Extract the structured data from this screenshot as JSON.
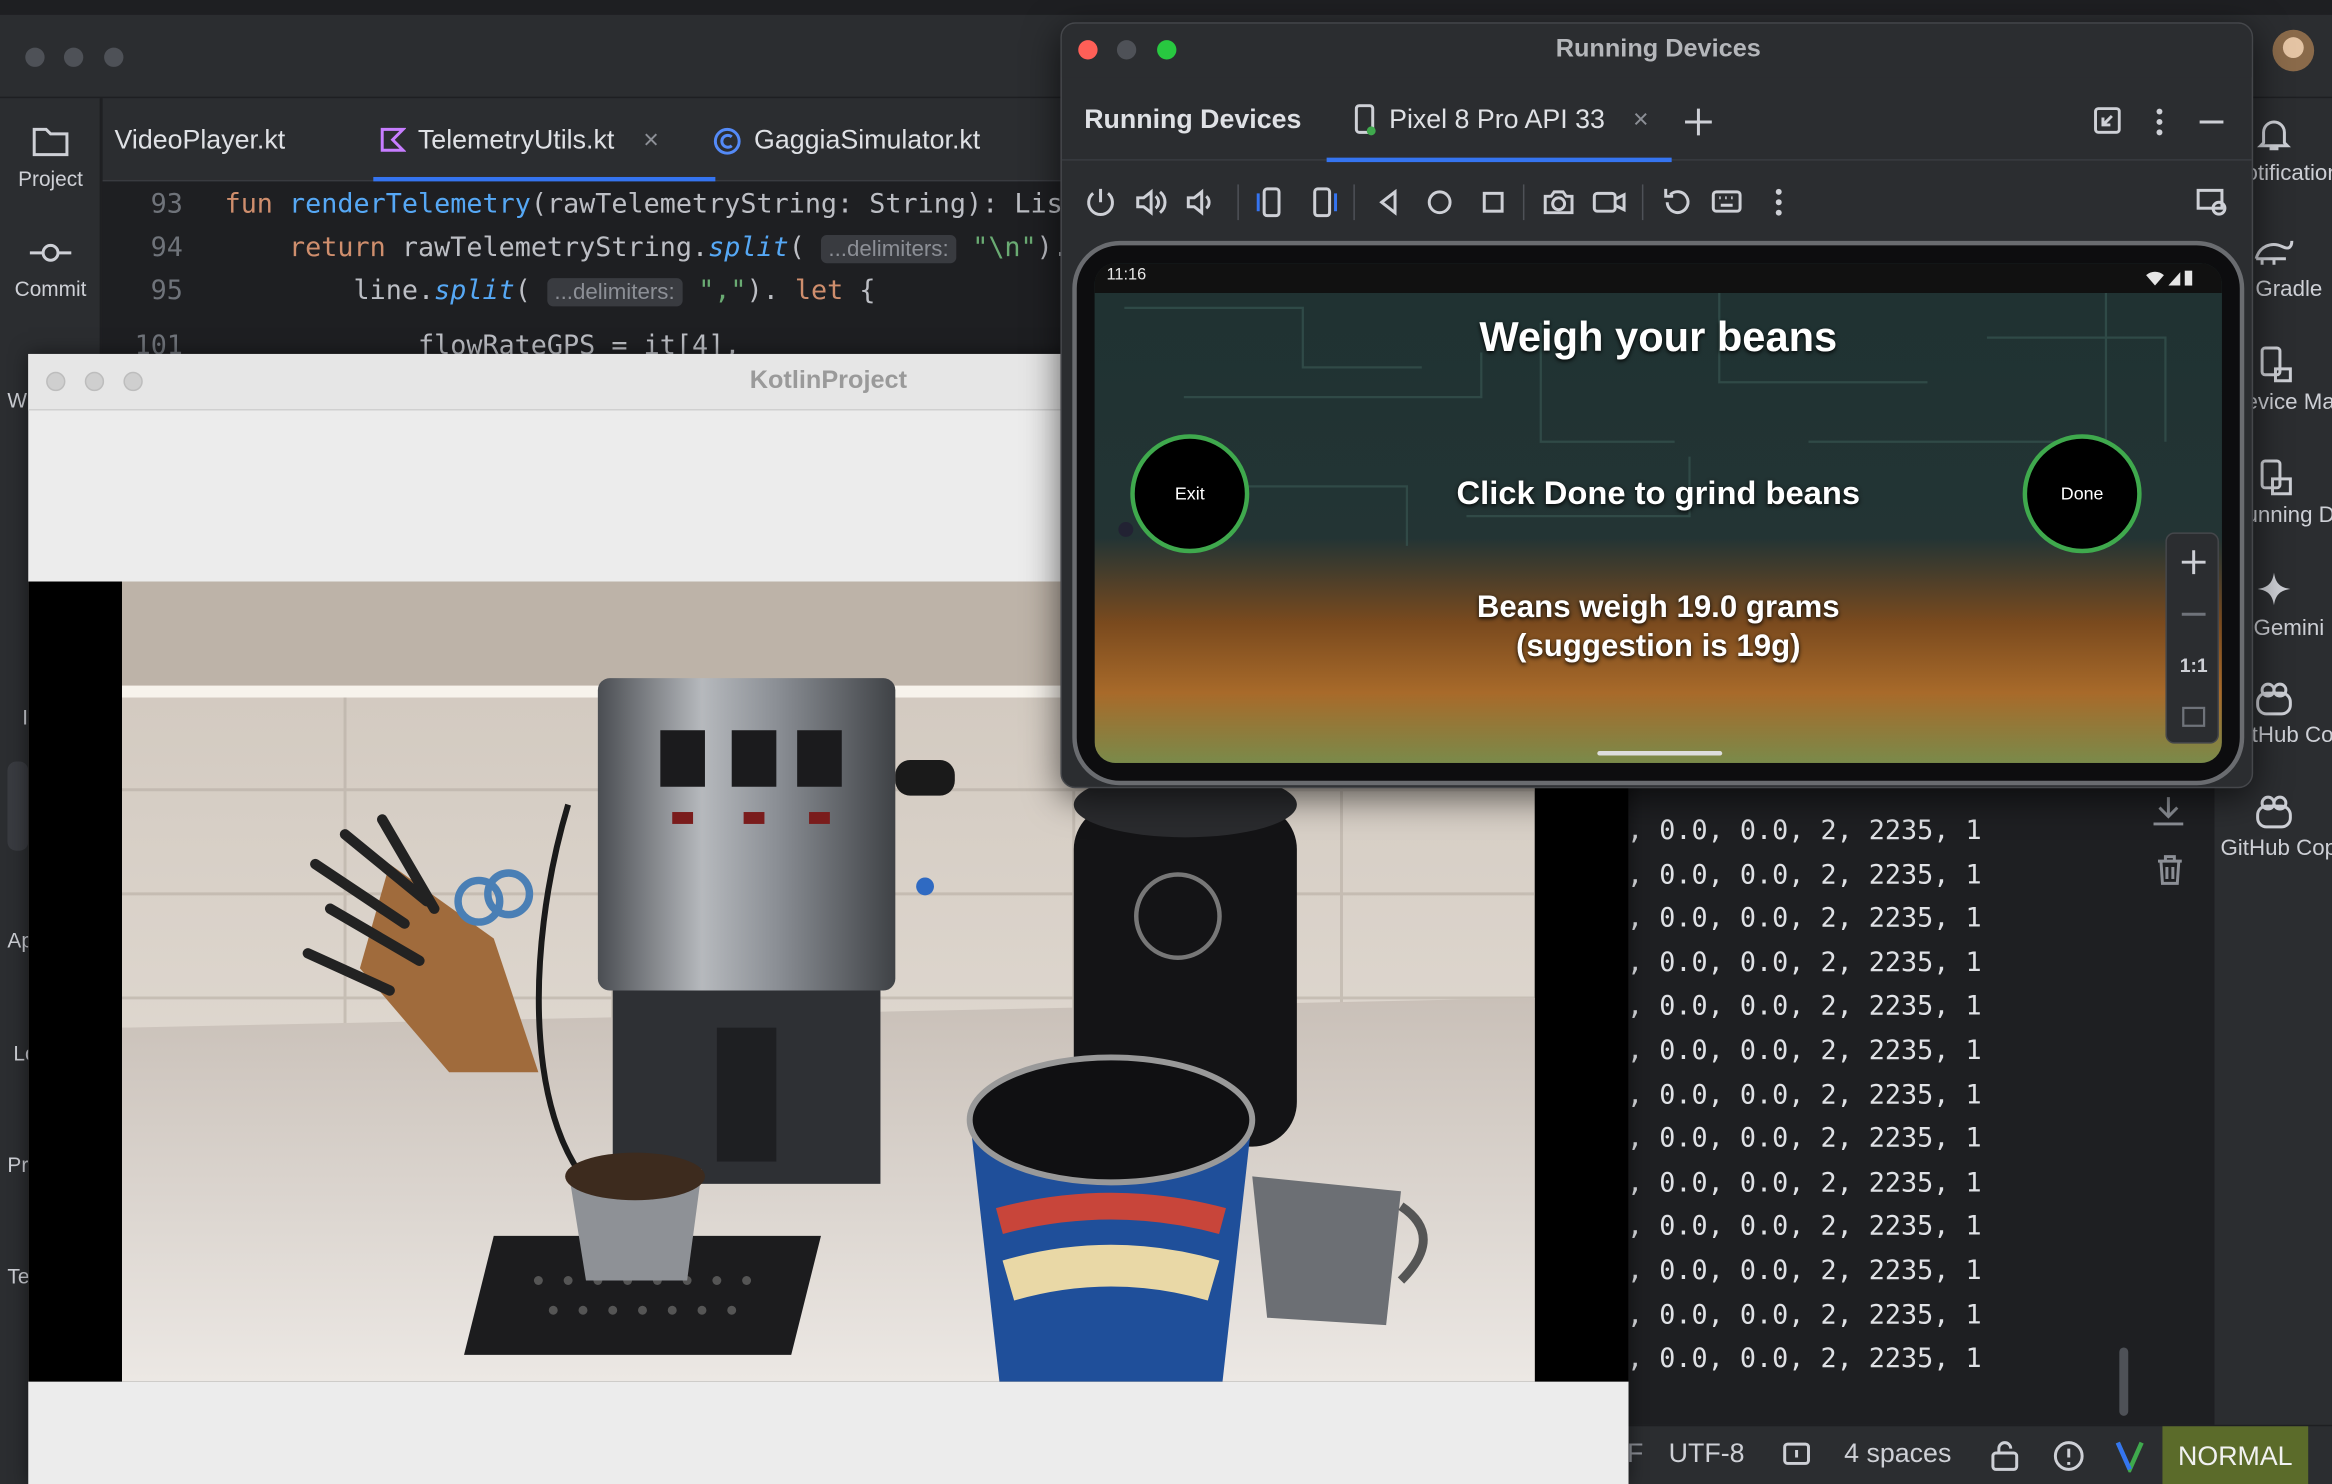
{
  "ide": {
    "tabs": [
      {
        "label": "VideoPlayer.kt"
      },
      {
        "label": "TelemetryUtils.kt"
      },
      {
        "label": "GaggiaSimulator.kt"
      }
    ],
    "left_tools": [
      {
        "label": "Project"
      },
      {
        "label": "Commit"
      }
    ],
    "left_cut_labels": [
      "W",
      "I",
      "Ap",
      "Lo",
      "Pr",
      "Te"
    ],
    "right_tools": [
      {
        "label": "Notifications"
      },
      {
        "label": "Gradle"
      },
      {
        "label": "Device Manager"
      },
      {
        "label": "Running Devices"
      },
      {
        "label": "Gemini"
      },
      {
        "label": "GitHub Copilot"
      },
      {
        "label": "GitHub Copilot Chat"
      }
    ],
    "code": [
      {
        "ln": "93",
        "t": [
          [
            "kw",
            "fun "
          ],
          [
            "fn",
            "renderTelemetry"
          ],
          [
            "",
            "(rawTelemetryString: String): List<"
          ]
        ]
      },
      {
        "ln": "94",
        "t": [
          [
            "",
            "    "
          ],
          [
            "kw",
            "return "
          ],
          [
            "",
            "rawTelemetryString."
          ],
          [
            "it",
            "split"
          ],
          [
            "",
            "( "
          ],
          [
            "hint",
            "...delimiters:"
          ],
          [
            "str",
            " \"\\n\""
          ],
          [
            "",
            "). "
          ],
          [
            "it",
            "m"
          ]
        ]
      },
      {
        "ln": "95",
        "t": [
          [
            "",
            "        line."
          ],
          [
            "it",
            "split"
          ],
          [
            "",
            "( "
          ],
          [
            "hint",
            "...delimiters:"
          ],
          [
            "str",
            " \",\""
          ],
          [
            "",
            "). "
          ],
          [
            "kw",
            "let"
          ],
          [
            "",
            " {"
          ]
        ]
      },
      {
        "ln": "101",
        "t": [
          [
            "",
            "            flowRateGPS = it[4],"
          ]
        ]
      }
    ],
    "console_lines": [
      ", 0.0, 0.0, 2, 2235, 1"
    ],
    "console_line_count": 13,
    "status": {
      "encoding": "UTF-8",
      "indent": "4 spaces",
      "mode": "NORMAL",
      "left_fragment": "F"
    }
  },
  "kotlin_window": {
    "title": "KotlinProject"
  },
  "running_devices": {
    "window_title": "Running Devices",
    "panel_title": "Running Devices",
    "device_tab": "Pixel 8 Pro API 33",
    "phone": {
      "time": "11:16",
      "heading": "Weigh your beans",
      "exit_label": "Exit",
      "done_label": "Done",
      "instruction": "Click Done to grind beans",
      "weight_line1": "Beans weigh 19.0 grams",
      "weight_line2": "(suggestion is 19g)"
    },
    "zoom_ratio": "1:1"
  },
  "colors": {
    "accent_blue": "#3574f0",
    "ring_green": "#3fa94d",
    "mode_bg": "#5b6b2a"
  }
}
